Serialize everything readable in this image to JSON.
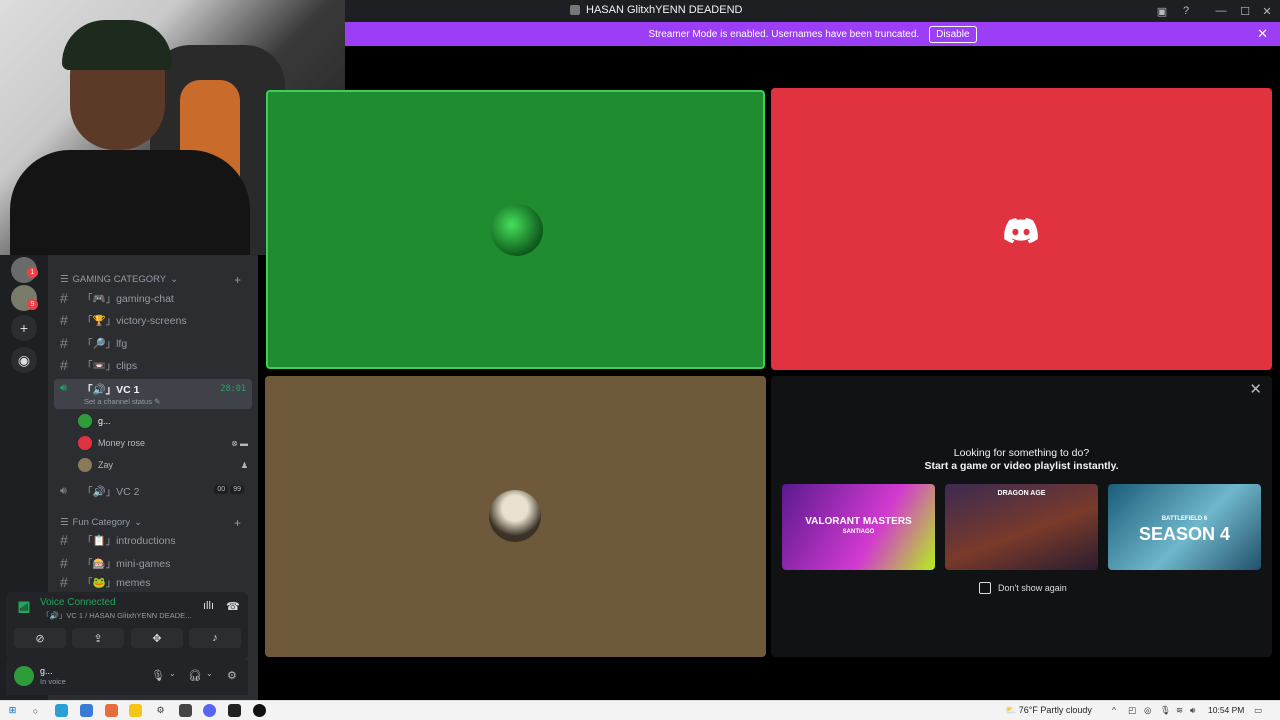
{
  "window": {
    "title": "HASAN GlitxhYENN DEADEND"
  },
  "banner": {
    "text": "Streamer Mode is enabled. Usernames have been truncated.",
    "button": "Disable"
  },
  "servers": {
    "badge1": "1",
    "badge2": "9"
  },
  "categories": [
    {
      "name": "GAMING CATEGORY",
      "channels": [
        "「🎮」gaming-chat",
        "「🏆」victory-screens",
        "「🔎」lfg",
        "「📼」clips"
      ]
    },
    {
      "name": "Fun Category",
      "channels": [
        "「📋」introductions",
        "「🎰」mini-games",
        "「🐸」memes"
      ]
    }
  ],
  "voice_channels": {
    "vc1": {
      "name": "「🔊」VC 1",
      "timer": "28:01",
      "status": "Set a channel status"
    },
    "vc2": {
      "name": "「🔊」VC 2",
      "count_a": "00",
      "count_b": "99"
    }
  },
  "members": [
    {
      "name": "g..."
    },
    {
      "name": "Money rose"
    },
    {
      "name": "Zay"
    }
  ],
  "voice_panel": {
    "title": "Voice Connected",
    "subtitle": "「🔊」VC 1 / HASAN GlitxhYENN DEADE..."
  },
  "user": {
    "name": "g...",
    "status": "In voice"
  },
  "activity": {
    "heading1": "Looking for something to do?",
    "heading2": "Start a game or video playlist instantly.",
    "games": [
      {
        "title": "VALORANT MASTERS",
        "subtitle": "SANTIAGO"
      },
      {
        "title": "DRAGON AGE",
        "subtitle": ""
      },
      {
        "title": "SEASON 4",
        "subtitle": "BATTLEFIELD 6"
      }
    ],
    "dont_show": "Don't show again"
  },
  "taskbar": {
    "temp": "76°F",
    "weather": "Partly cloudy",
    "time": "10:54 PM"
  },
  "colors": {
    "accent_purple": "#9b3ef5",
    "green_tile": "#1f8d2f",
    "red_tile": "#e1323f",
    "brown_tile": "#6e5a3b",
    "voice_green": "#23a55a"
  }
}
